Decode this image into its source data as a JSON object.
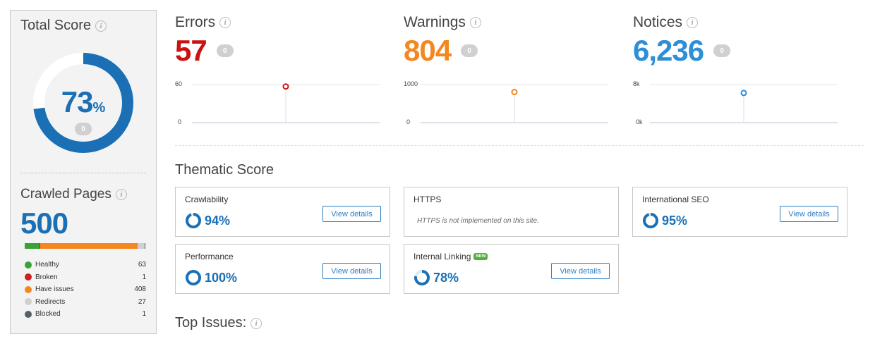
{
  "total_score": {
    "title": "Total Score",
    "value": "73",
    "unit": "%",
    "percent": 73,
    "change": "0",
    "ring_color": "#1a6fb5",
    "ring_bg": "#ffffff"
  },
  "crawled": {
    "title": "Crawled Pages",
    "value": "500",
    "legend": [
      {
        "label": "Healthy",
        "count": "63",
        "color": "#3aa335",
        "share": 0.126
      },
      {
        "label": "Broken",
        "count": "1",
        "color": "#cc1f1f",
        "share": 0.002
      },
      {
        "label": "Have issues",
        "count": "408",
        "color": "#f5871f",
        "share": 0.816
      },
      {
        "label": "Redirects",
        "count": "27",
        "color": "#d0d0d0",
        "share": 0.054
      },
      {
        "label": "Blocked",
        "count": "1",
        "color": "#556066",
        "share": 0.002
      }
    ]
  },
  "metrics": [
    {
      "title": "Errors",
      "value": "57",
      "change": "0",
      "color": "#cc1111",
      "y_top": "60",
      "y_bottom": "0",
      "point": 57,
      "max": 60
    },
    {
      "title": "Warnings",
      "value": "804",
      "change": "0",
      "color": "#f5871f",
      "y_top": "1000",
      "y_bottom": "0",
      "point": 804,
      "max": 1000
    },
    {
      "title": "Notices",
      "value": "6,236",
      "change": "0",
      "color": "#2d8fd6",
      "y_top": "8k",
      "y_bottom": "0k",
      "point": 6236,
      "max": 8000
    }
  ],
  "thematic": {
    "title": "Thematic Score",
    "cards": [
      {
        "title": "Crawlability",
        "score": "94%",
        "percent": 94,
        "button": "View details"
      },
      {
        "title": "HTTPS",
        "note": "HTTPS is not implemented on this site."
      },
      {
        "title": "International SEO",
        "score": "95%",
        "percent": 95,
        "button": "View details"
      },
      {
        "title": "Performance",
        "score": "100%",
        "percent": 100,
        "button": "View details"
      },
      {
        "title": "Internal Linking",
        "badge": "NEW",
        "score": "78%",
        "percent": 78,
        "button": "View details"
      }
    ]
  },
  "top_issues": {
    "title": "Top Issues:"
  },
  "icons": {
    "info": "info-icon"
  }
}
